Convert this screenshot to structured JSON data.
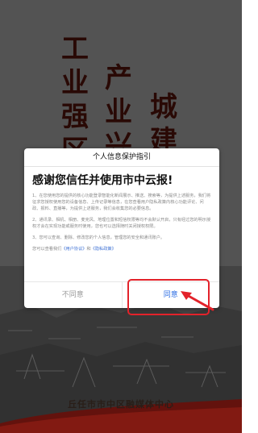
{
  "splash": {
    "slogan_left": [
      "工",
      "业",
      "强",
      "区"
    ],
    "slogan_mid": [
      "产",
      "业",
      "兴"
    ],
    "slogan_right": [
      "城",
      "建"
    ],
    "footer": "丘任市市中区融媒体中心"
  },
  "dialog": {
    "header": "个人信息保护指引",
    "title": "感谢您信任并使用市中云报!",
    "paragraphs": [
      "1、在您使用您的提供的核心功能登录智能化新闻展示、推送、搜索等，为提供上述服务，我们将征求您授权使用您的设备信息、上传记录等信息，在您查看用户隐私政策内核心功能评论、问政、报料、直播等，为提供上述服务，我们会收集您的必要信息。",
      "2、通讯录、相机、相册、麦克风、地理位置和短信权限等均不会默认开启，只有经过您的明示授权才会在实现功能或服务时使用，您也可以选择随时关闭授权权限。",
      "3、您可以查询、删除、修改您的个人信息，管理您的安全和通讯账户。"
    ],
    "links_prefix": "您可以查看我们",
    "link_user_agreement": "《用户协议》",
    "links_and": "和",
    "link_privacy": "《隐私政策》",
    "deny_label": "不同意",
    "agree_label": "同意"
  },
  "colors": {
    "highlight": "#e3222a",
    "agree": "#2f6fe4",
    "slogan": "#3a0d08"
  }
}
